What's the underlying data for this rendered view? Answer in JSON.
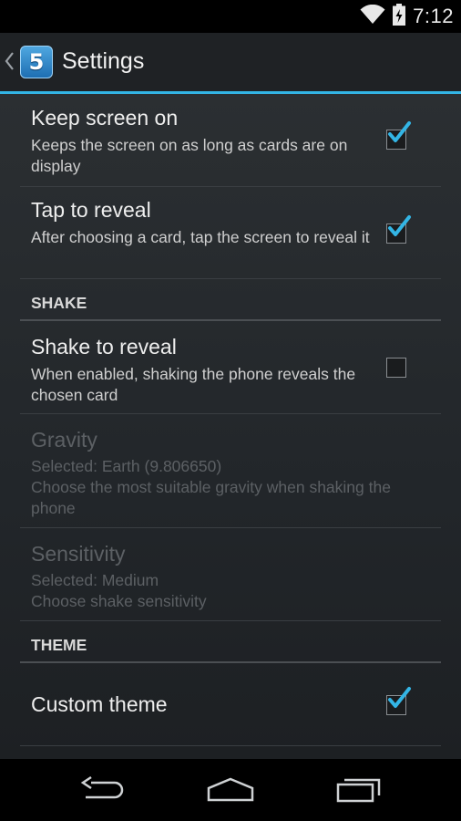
{
  "status_bar": {
    "time": "7:12",
    "icons": [
      "wifi-icon",
      "battery-charging-icon"
    ]
  },
  "action_bar": {
    "title": "Settings",
    "app_icon_text": "5",
    "accent_color": "#33b5e5"
  },
  "settings": {
    "keep_screen_on": {
      "title": "Keep screen on",
      "summary": "Keeps the screen on as long as cards are on display",
      "checked": true
    },
    "tap_to_reveal": {
      "title": "Tap to reveal",
      "summary": "After choosing a card, tap the screen to reveal it",
      "checked": true
    },
    "shake_header": "SHAKE",
    "shake_to_reveal": {
      "title": "Shake to reveal",
      "summary": "When enabled, shaking the phone reveals the chosen card",
      "checked": false
    },
    "gravity": {
      "title": "Gravity",
      "selected": "Selected: Earth (9.806650)",
      "summary": "Choose the most suitable gravity when shaking the phone",
      "enabled": false
    },
    "sensitivity": {
      "title": "Sensitivity",
      "selected": "Selected: Medium",
      "summary": "Choose shake sensitivity",
      "enabled": false
    },
    "theme_header": "THEME",
    "custom_theme": {
      "title": "Custom theme",
      "checked": true
    }
  },
  "nav_bar": {
    "buttons": [
      "back-icon",
      "home-icon",
      "recent-apps-icon"
    ]
  }
}
